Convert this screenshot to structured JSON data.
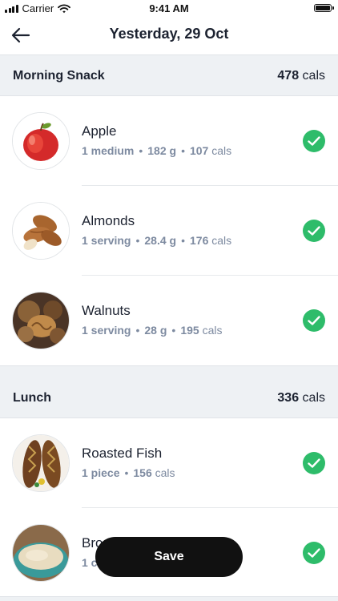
{
  "status_bar": {
    "carrier": "Carrier",
    "time": "9:41 AM",
    "battery_level": 1.0
  },
  "nav": {
    "title": "Yesterday, 29 Oct",
    "back_icon": "arrow-left-icon"
  },
  "sections": [
    {
      "title": "Morning Snack",
      "cals_value": "478",
      "cals_unit": "cals",
      "items": [
        {
          "name": "Apple",
          "amount": "1 medium",
          "weight": "182 g",
          "cals_value": "107",
          "cals_unit": "cals",
          "image": "apple"
        },
        {
          "name": "Almonds",
          "amount": "1 serving",
          "weight": "28.4 g",
          "cals_value": "176",
          "cals_unit": "cals",
          "image": "almonds"
        },
        {
          "name": "Walnuts",
          "amount": "1 serving",
          "weight": "28 g",
          "cals_value": "195",
          "cals_unit": "cals",
          "image": "walnuts"
        }
      ]
    },
    {
      "title": "Lunch",
      "cals_value": "336",
      "cals_unit": "cals",
      "items": [
        {
          "name": "Roasted Fish",
          "amount": "1 piece",
          "cals_value": "156",
          "cals_unit": "cals",
          "image": "roasted-fish"
        },
        {
          "name": "Bro",
          "amount": "1 c",
          "image": "quinoa"
        }
      ]
    }
  ],
  "save_label": "Save",
  "colors": {
    "check_green": "#2ebc6a",
    "section_bg": "#eef1f4",
    "meta_gray": "#7d8aa0",
    "save_bg": "#111111"
  }
}
